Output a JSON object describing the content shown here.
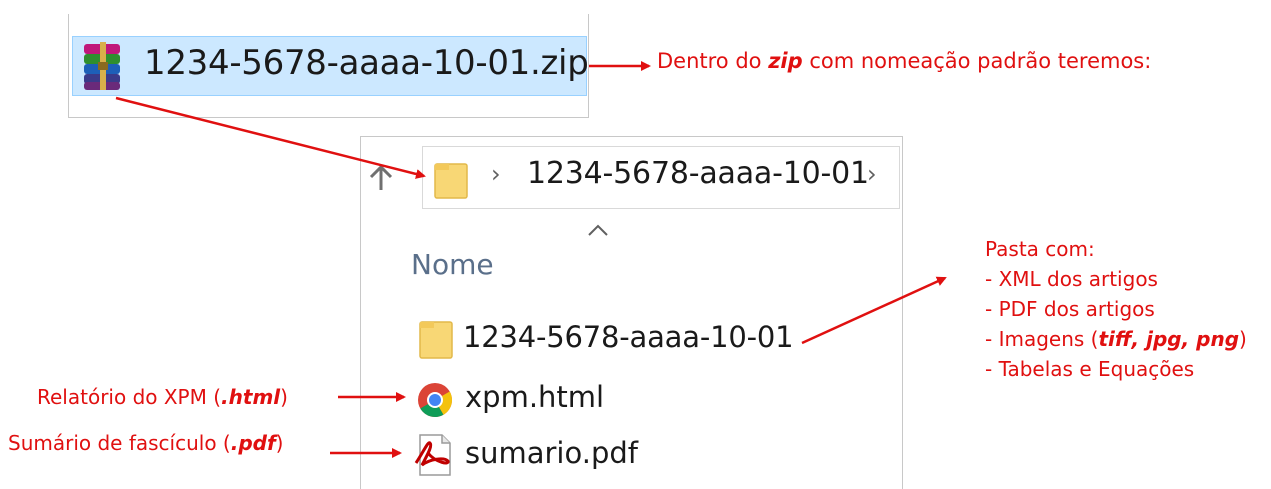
{
  "zip": {
    "filename": "1234-5678-aaaa-10-01.zip",
    "icon": "winrar-archive-icon"
  },
  "explorer": {
    "breadcrumb_folder": "1234-5678-aaaa-10-01",
    "column_header": "Nome",
    "files": [
      {
        "name": "1234-5678-aaaa-10-01",
        "icon": "folder-icon"
      },
      {
        "name": "xpm.html",
        "icon": "chrome-icon"
      },
      {
        "name": "sumario.pdf",
        "icon": "pdf-icon"
      }
    ]
  },
  "annotations": {
    "zip_note": {
      "prefix": "Dentro do ",
      "emphasis": "zip",
      "suffix": " com nomeação padrão teremos:"
    },
    "pasta_title": "Pasta com:",
    "pasta_items": [
      "- XML dos artigos",
      "- PDF dos artigos"
    ],
    "pasta_images": {
      "prefix": "- Imagens (",
      "emphasis": "tiff, jpg, png",
      "suffix": ")"
    },
    "pasta_last": "- Tabelas e Equações",
    "xpm_note": {
      "prefix": "Relatório do XPM (",
      "emphasis": ".html",
      "suffix": ")"
    },
    "sumario_note": {
      "prefix": "Sumário de fascículo (",
      "emphasis": ".pdf",
      "suffix": ")"
    }
  },
  "colors": {
    "annotation": "#e01010",
    "selection": "#cce8ff",
    "folder": "#f8d775"
  }
}
